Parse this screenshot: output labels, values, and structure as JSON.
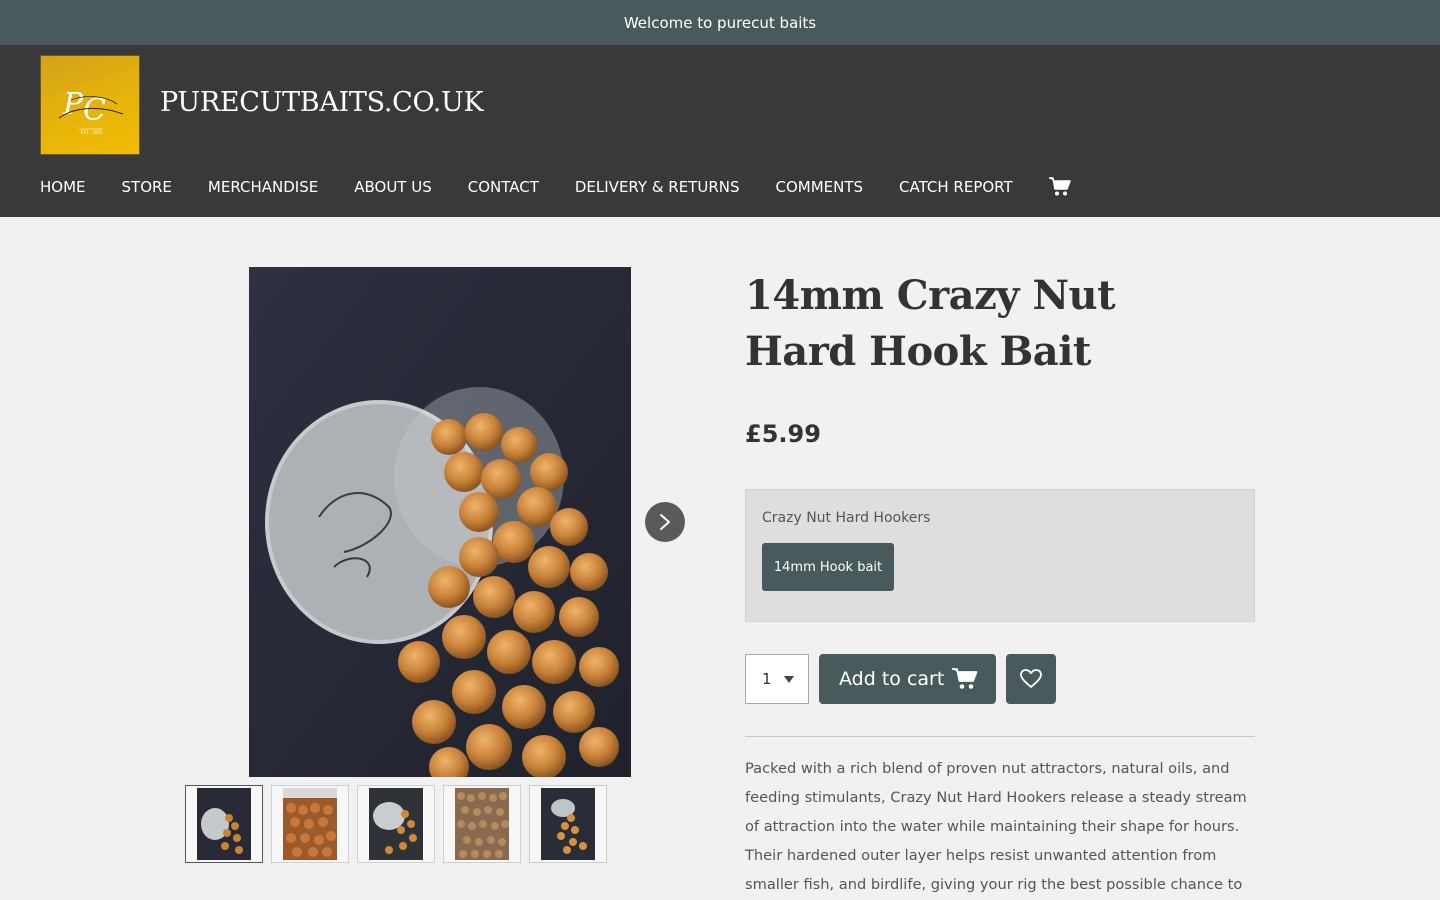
{
  "announcement": {
    "text": "Welcome to purecut baits"
  },
  "header": {
    "site_title": "PURECUTBAITS.CO.UK",
    "logo_icon": "pc-monogram-logo",
    "brand_gold": "#e6b40a",
    "header_bg": "#393939",
    "announce_bg": "#4a5a5c"
  },
  "nav": {
    "items": [
      {
        "label": "HOME"
      },
      {
        "label": "STORE"
      },
      {
        "label": "MERCHANDISE"
      },
      {
        "label": "ABOUT US"
      },
      {
        "label": "CONTACT"
      },
      {
        "label": "DELIVERY & RETURNS"
      },
      {
        "label": "COMMENTS"
      },
      {
        "label": "CATCH REPORT"
      }
    ],
    "cart_icon": "cart-icon"
  },
  "gallery": {
    "main_image": "jar-of-boilies-photo",
    "next_icon": "chevron-right-icon",
    "thumbnails": [
      {
        "name": "thumb-1",
        "active": true
      },
      {
        "name": "thumb-2",
        "active": false
      },
      {
        "name": "thumb-3",
        "active": false
      },
      {
        "name": "thumb-4",
        "active": false
      },
      {
        "name": "thumb-5",
        "active": false
      }
    ]
  },
  "product": {
    "title": "14mm Crazy Nut Hard Hook Bait",
    "price": "£5.99",
    "variant_label": "Crazy Nut Hard Hookers",
    "variant_option": "14mm Hook bait",
    "quantity": "1",
    "add_to_cart_label": "Add to cart",
    "wishlist_icon": "heart-icon",
    "accent": "#485a5c",
    "description": "Packed with a rich blend of proven nut attractors, natural oils, and feeding stimulants, Crazy Nut Hard Hookers release a steady stream of attraction into the water while maintaining their shape for hours. Their hardened outer layer helps resist unwanted attention from smaller fish, and birdlife, giving your rig the best possible chance to stay effective for longer."
  }
}
